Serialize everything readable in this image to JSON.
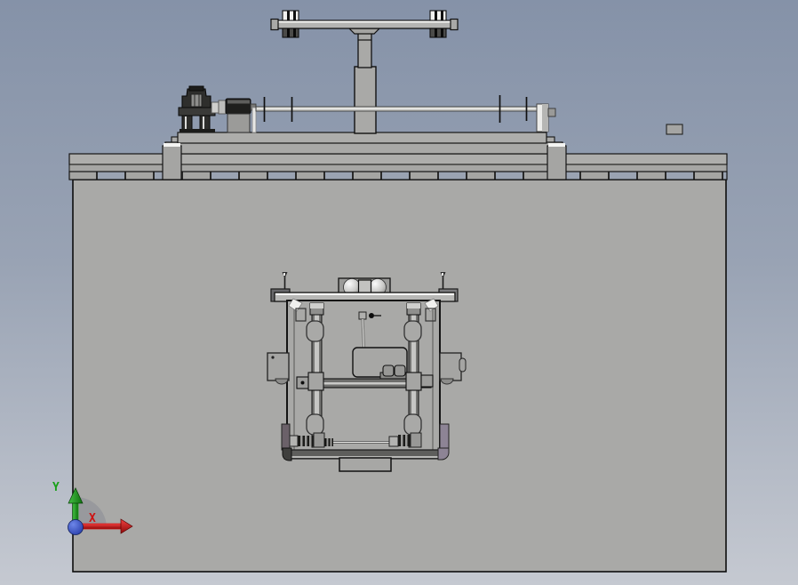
{
  "viewport": {
    "axis_triad": {
      "y_label": "Y",
      "x_label": "X"
    },
    "colors": {
      "background_top": "#8592a8",
      "background_mid": "#99a3b4",
      "background_bottom": "#c5c9d1",
      "plate": "#a9a9a7",
      "band_gray": "#a6a6a4",
      "segment_blue": "#9aa3b2",
      "axis_y_green": "#18a018",
      "axis_x_red": "#cf1212",
      "origin_blue_light": "#6d86e8",
      "origin_blue_dark": "#1a2f9e",
      "trim_purple": "#8d8495",
      "trim_purple_dark": "#6b6169"
    }
  }
}
